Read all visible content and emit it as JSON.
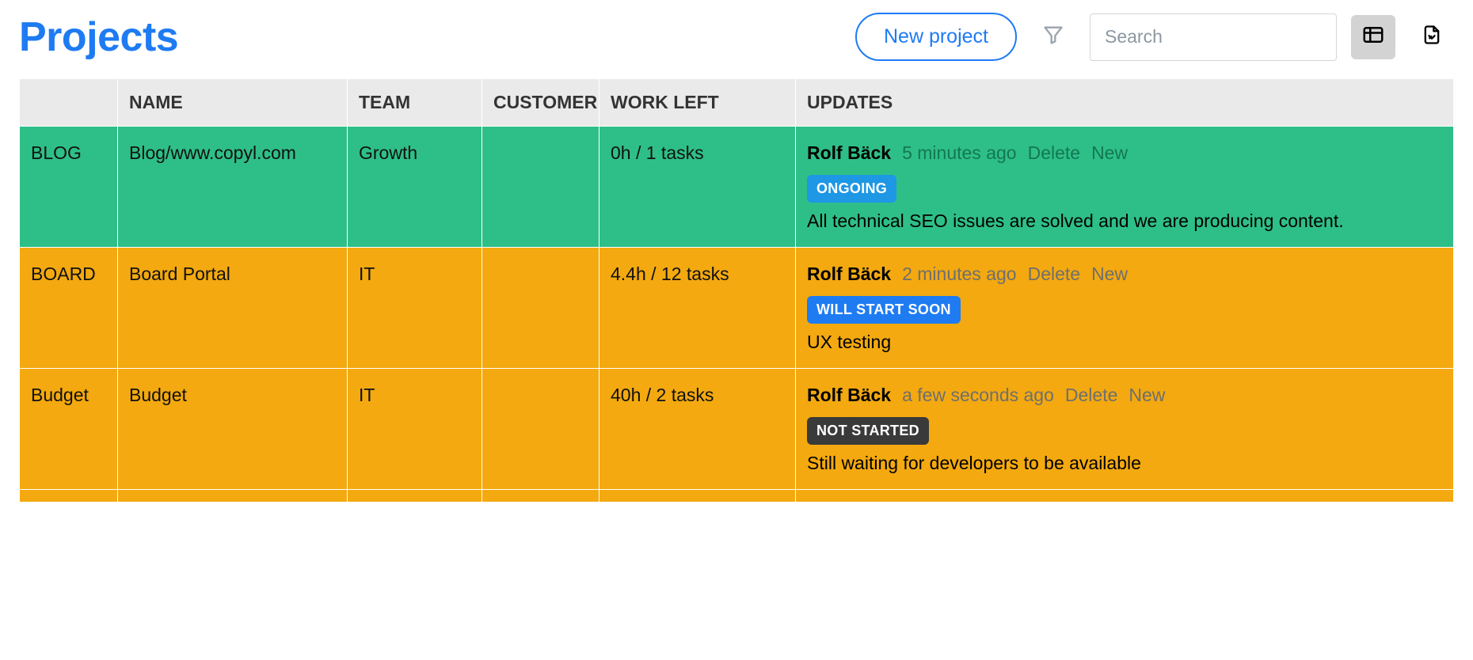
{
  "header": {
    "title": "Projects",
    "new_project_label": "New project",
    "search_placeholder": "Search"
  },
  "table": {
    "columns": {
      "code": "",
      "name": "NAME",
      "team": "TEAM",
      "customer": "CUSTOMER",
      "workleft": "WORK LEFT",
      "updates": "UPDATES"
    },
    "rows": [
      {
        "code": "BLOG",
        "name": "Blog/www.copyl.com",
        "team": "Growth",
        "customer": "",
        "workleft": "0h / 1 tasks",
        "update": {
          "author": "Rolf Bäck",
          "time": "5 minutes ago",
          "delete_label": "Delete",
          "new_label": "New",
          "status_label": "ONGOING",
          "status_class": "status-ongoing",
          "text": "All technical SEO issues are solved and we are producing content."
        },
        "row_class": "row-green"
      },
      {
        "code": "BOARD",
        "name": "Board Portal",
        "team": "IT",
        "customer": "",
        "workleft": "4.4h / 12 tasks",
        "update": {
          "author": "Rolf Bäck",
          "time": "2 minutes ago",
          "delete_label": "Delete",
          "new_label": "New",
          "status_label": "WILL START SOON",
          "status_class": "status-willstart",
          "text": "UX testing"
        },
        "row_class": "row-orange"
      },
      {
        "code": "Budget",
        "name": "Budget",
        "team": "IT",
        "customer": "",
        "workleft": "40h / 2 tasks",
        "update": {
          "author": "Rolf Bäck",
          "time": "a few seconds ago",
          "delete_label": "Delete",
          "new_label": "New",
          "status_label": "NOT STARTED",
          "status_class": "status-notstarted",
          "text": "Still waiting for developers to be available"
        },
        "row_class": "row-orange"
      }
    ]
  }
}
